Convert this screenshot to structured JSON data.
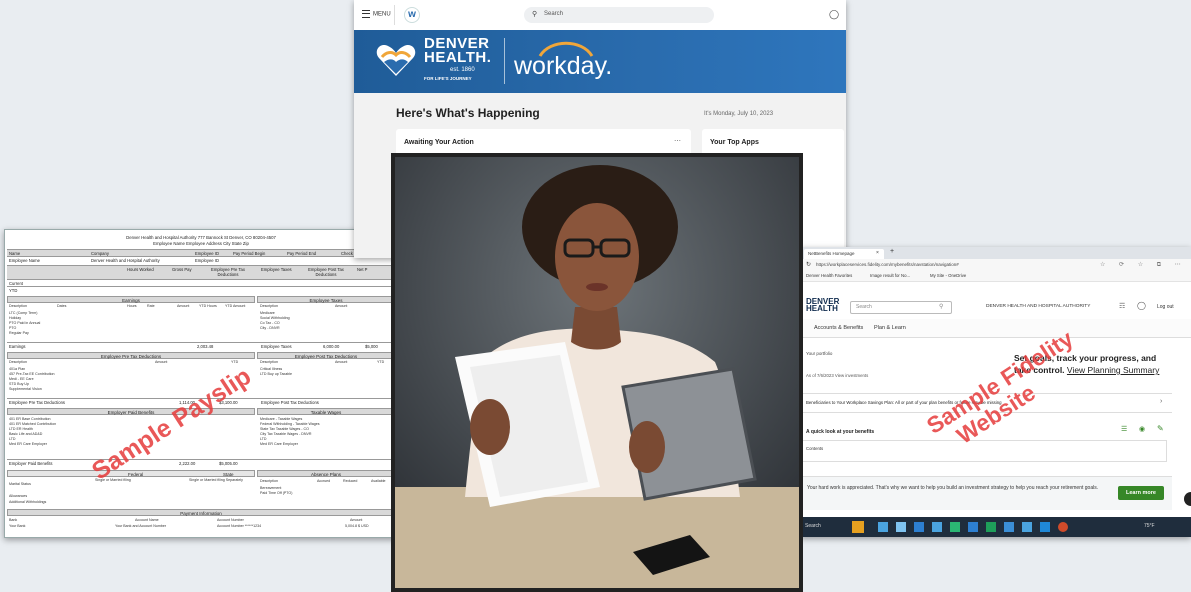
{
  "colors": {
    "workday_blue": "#2a6cae",
    "accent_orange": "#f0a63a",
    "watermark_red": "#e63b3b",
    "fidelity_green": "#368727",
    "denver_dark": "#0e2a4d"
  },
  "workday": {
    "menu_label": "MENU",
    "search_placeholder": "Search",
    "brand_line1": "DENVER",
    "brand_line2": "HEALTH.",
    "brand_est": "est. 1860",
    "brand_tagline": "FOR LIFE'S JOURNEY",
    "workday_logo": "workday.",
    "heading": "Here's What's Happening",
    "date": "It's Monday, July 10, 2023",
    "card1_title": "Awaiting Your Action",
    "card2_title": "Your Top Apps"
  },
  "payslip": {
    "header_line1": "Denver Health and Hospital Authority   777 Bannock St Denver, CO 80204-4507",
    "header_line2": "Employee Name   Employee Address   City State Zip",
    "top_headers": [
      "Name",
      "Company",
      "Employee ID",
      "Pay Period Begin",
      "Pay Period End",
      "Check D"
    ],
    "top_values": [
      "Employee Name",
      "Denver Health and Hospital Authority",
      "Employee ID"
    ],
    "summary_headers": [
      "Hours Worked",
      "Gross Pay",
      "Employee Pre Tax Deductions",
      "Employee Taxes",
      "Employee Post Tax Deductions",
      "Net P"
    ],
    "summary_rows": [
      "Current",
      "YTD"
    ],
    "earnings_title": "Earnings",
    "earnings_cols": [
      "Description",
      "Dates",
      "Hours",
      "Rate",
      "Amount",
      "YTD Hours",
      "YTD Amount"
    ],
    "earnings_rows": [
      "LTC (Comp Term)",
      "Holiday",
      "PTO Paid in Annual",
      "PTO",
      "Regular Pay"
    ],
    "earnings_total": "Earnings",
    "earnings_amount": "2,003.48",
    "taxes_title": "Employee Taxes",
    "taxes_cols": [
      "Description",
      "Amount"
    ],
    "taxes_rows": [
      "Medicare",
      "Social Withholding",
      "Co Tax - CO",
      "City - DNVR"
    ],
    "taxes_total": "Employee Taxes",
    "taxes_amount": "6,000.00",
    "taxes_ytd": "$5,000",
    "pretax_title": "Employee Pre Tax Deductions",
    "pretax_cols": [
      "Description",
      "Amount",
      "YTD"
    ],
    "pretax_rows": [
      "401a Plan",
      "457 Pre-Tax EE Contribution",
      "Medi - EE Care",
      "STD Buy Up",
      "Supplemental Vision"
    ],
    "pretax_total": "Employee Pre Tax Deductions",
    "pretax_amount": "1,114.00",
    "pretax_ytd": "$3,100.00",
    "posttax_title": "Employee Post Tax Deductions",
    "posttax_cols": [
      "Description",
      "Amount",
      "YTD"
    ],
    "posttax_rows": [
      "Critical Illness",
      "LTD Buy up Taxable"
    ],
    "posttax_total": "Employee Post Tax Deductions",
    "paid_title": "Employer Paid Benefits",
    "paid_rows": [
      "401 ER Base Contribution",
      "401 ER Matched Contribution",
      "LTD ER Health",
      "Basic Life and AD&D",
      "LTD",
      "Med ER Care Employer"
    ],
    "paid_total": "Employer Paid Benefits",
    "paid_amount": "2,222.00",
    "paid_ytd": "$5,005.00",
    "wages_title": "Taxable Wages",
    "wages_rows": [
      "Medicare - Taxable Wages",
      "Federal Withholding - Taxable Wages",
      "State Tax Taxable Wages - CO",
      "City Tax Taxable Wages - DNVR",
      "LTD",
      "Med ER Care Employer"
    ],
    "federal_label": "Federal",
    "state_label": "State",
    "marital_label": "Marital Status",
    "marital_value": "Single or Married filing",
    "marital_value2": "Single or Married filing Separately",
    "allowances_label": "Allowances",
    "additional_label": "Additional Withholdings",
    "absence_title": "Absence Plans",
    "absence_cols": [
      "Description",
      "Accrued",
      "Reduced",
      "Available"
    ],
    "absence_rows": [
      "Bereavement",
      "Paid Time Off (PTO)"
    ],
    "payment_title": "Payment Information",
    "payment_cols": [
      "Bank",
      "Account Name",
      "Account Number",
      "Amount"
    ],
    "payment_row": [
      "Your Bank",
      "Your Bank and Account Number",
      "Account Number ******1234",
      "5,004.8 $ USD"
    ]
  },
  "fidelity": {
    "tab_title": "NetBenefits Homepage",
    "url": "https://workplaceservices.fidelity.com/mybenefits/navstation/navigation#",
    "bookmarks": [
      "Denver Health Favorites",
      "Image result for No...",
      "My Site - OneDrive"
    ],
    "brand": "DENVER HEALTH",
    "search_placeholder": "Search",
    "employer": "DENVER HEALTH AND HOSPITAL AUTHORITY",
    "logout": "Log out",
    "nav": [
      "Accounts & Benefits",
      "Plan & Learn"
    ],
    "your_portfolio": "Your portfolio",
    "as_of": "As of 7/6/2023 View investments",
    "headline": "Set goals, track your progress, and",
    "headline2": "take control.",
    "headline_link": "View Planning Summary",
    "beneficiary_text": "Beneficiaries to Your Workplace Savings Plan: All or part of your plan benefits or future may be missing",
    "quick_look": "A quick look at your benefits",
    "quick_sub": "Contents",
    "appreciation": "Your hard work is appreciated. That's why we want to help you build an investment strategy to help you reach your retirement goals.",
    "learn_more": "Learn more",
    "taskbar_search": "Search",
    "tray_temp": "75°F"
  },
  "watermarks": {
    "payslip": "Sample Payslip",
    "fidelity1": "Sample Fidelity",
    "fidelity2": "Website"
  }
}
